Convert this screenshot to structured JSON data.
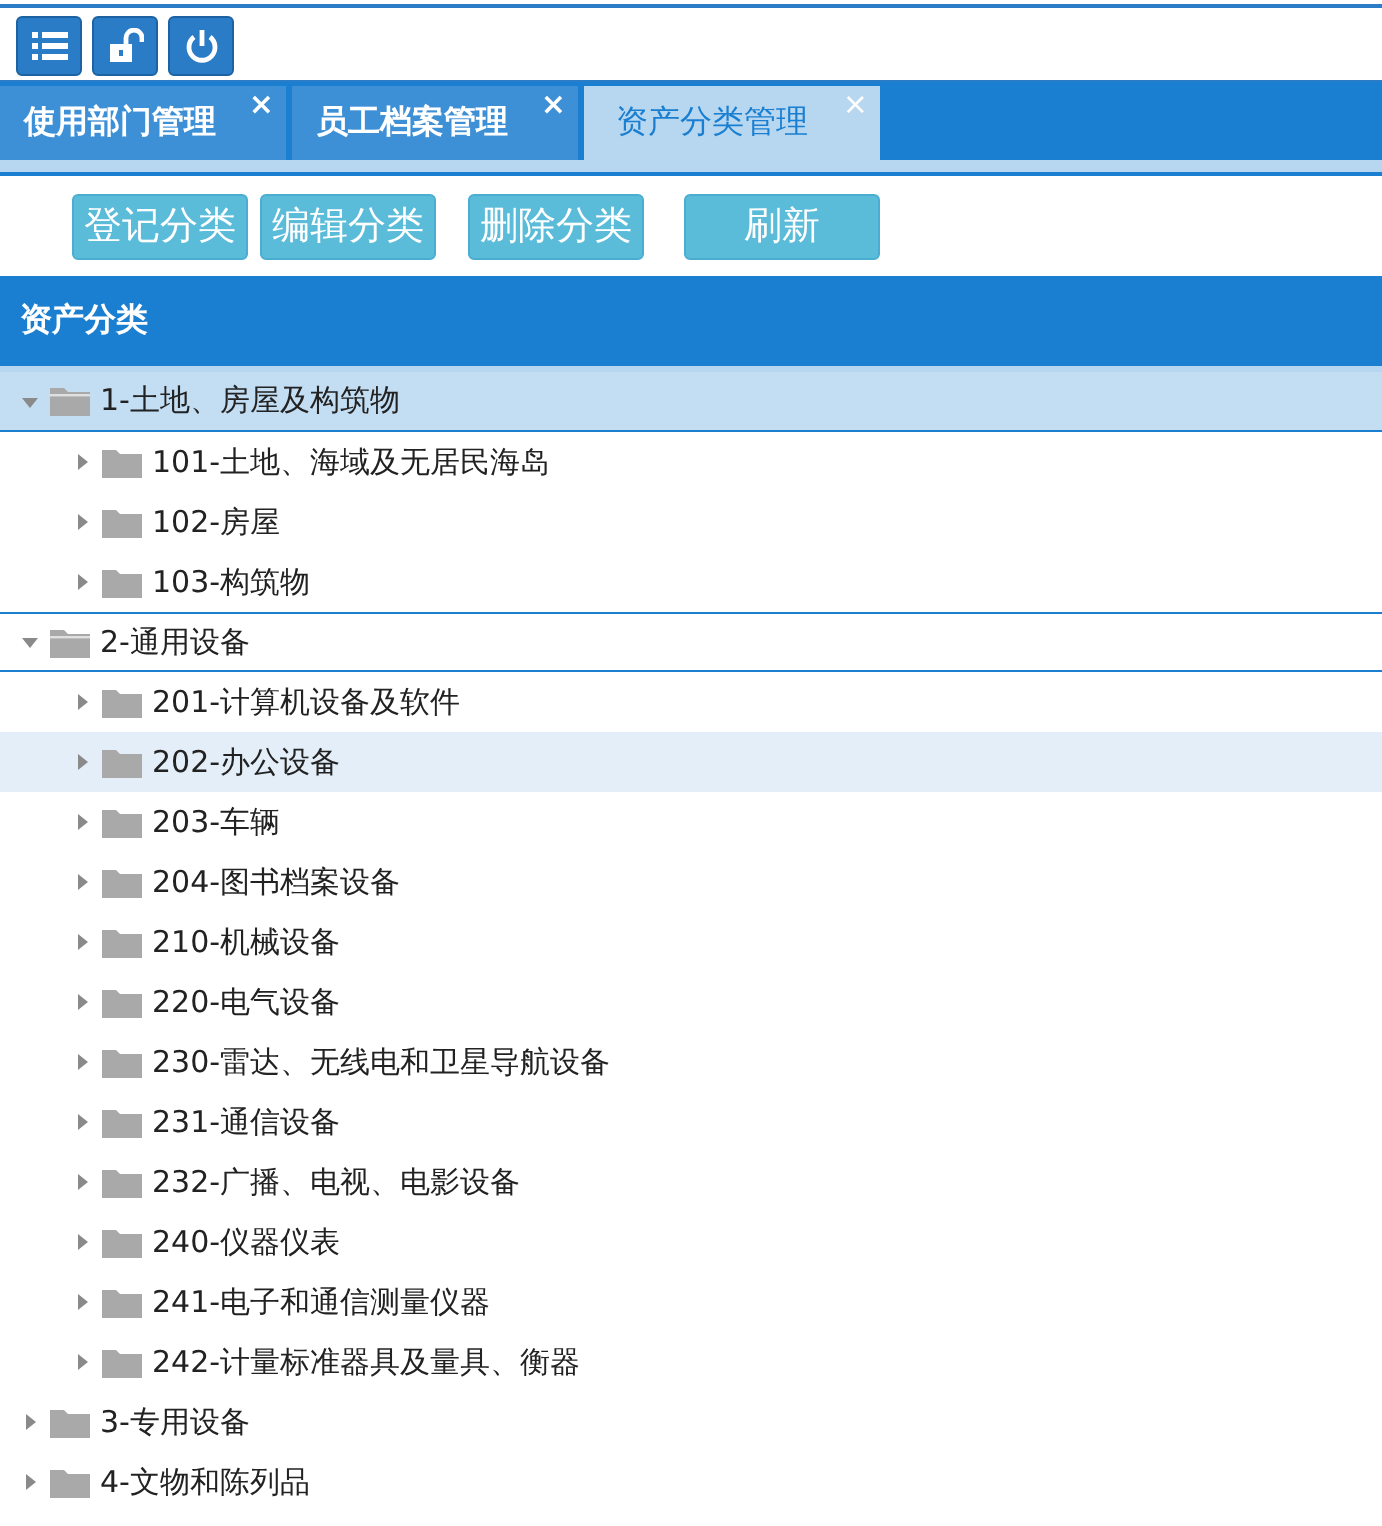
{
  "toolbar_icons": [
    {
      "kind": "menu"
    },
    {
      "kind": "unlock"
    },
    {
      "kind": "power"
    }
  ],
  "tabs": [
    {
      "label": "使用部门管理",
      "close": "×",
      "selected": false
    },
    {
      "label": "员工档案管理",
      "close": "×",
      "selected": false
    },
    {
      "label": "资产分类管理",
      "close": "×",
      "selected": true
    }
  ],
  "buttons": [
    "登记分类",
    "编辑分类",
    "删除分类",
    "刷新"
  ],
  "panel": {
    "title": "资产分类"
  },
  "tree": [
    {
      "label": "1-土地、房屋及构筑物",
      "expanded": true,
      "selected": true,
      "hovered": false,
      "children": [
        {
          "label": "101-土地、海域及无居民海岛",
          "expanded": false,
          "selected": false,
          "hovered": false
        },
        {
          "label": "102-房屋",
          "expanded": false,
          "selected": false,
          "hovered": false
        },
        {
          "label": "103-构筑物",
          "expanded": false,
          "selected": false,
          "hovered": false
        }
      ]
    },
    {
      "label": "2-通用设备",
      "expanded": true,
      "selected": false,
      "hovered": false,
      "children": [
        {
          "label": "201-计算机设备及软件",
          "expanded": false,
          "selected": false,
          "hovered": false
        },
        {
          "label": "202-办公设备",
          "expanded": false,
          "selected": false,
          "hovered": true
        },
        {
          "label": "203-车辆",
          "expanded": false,
          "selected": false,
          "hovered": false
        },
        {
          "label": "204-图书档案设备",
          "expanded": false,
          "selected": false,
          "hovered": false
        },
        {
          "label": "210-机械设备",
          "expanded": false,
          "selected": false,
          "hovered": false
        },
        {
          "label": "220-电气设备",
          "expanded": false,
          "selected": false,
          "hovered": false
        },
        {
          "label": "230-雷达、无线电和卫星导航设备",
          "expanded": false,
          "selected": false,
          "hovered": false
        },
        {
          "label": "231-通信设备",
          "expanded": false,
          "selected": false,
          "hovered": false
        },
        {
          "label": "232-广播、电视、电影设备",
          "expanded": false,
          "selected": false,
          "hovered": false
        },
        {
          "label": "240-仪器仪表",
          "expanded": false,
          "selected": false,
          "hovered": false
        },
        {
          "label": "241-电子和通信测量仪器",
          "expanded": false,
          "selected": false,
          "hovered": false
        },
        {
          "label": "242-计量标准器具及量具、衡器",
          "expanded": false,
          "selected": false,
          "hovered": false
        }
      ]
    },
    {
      "label": "3-专用设备",
      "expanded": false,
      "selected": false,
      "hovered": false
    },
    {
      "label": "4-文物和陈列品",
      "expanded": false,
      "selected": false,
      "hovered": false
    }
  ]
}
